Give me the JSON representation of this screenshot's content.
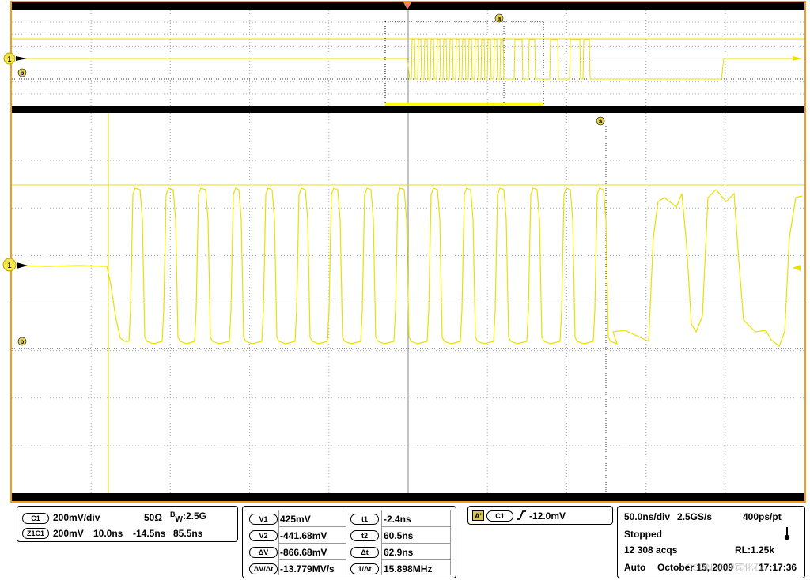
{
  "colors": {
    "frame": "#f59a23",
    "grid": "#9a9a9a",
    "trace": "#e8e000",
    "cursor": "#e8e000",
    "bar": "#000000",
    "background": "#ffffff"
  },
  "overview": {
    "markers": {
      "channel": "1",
      "ref_b": "b",
      "cursor_a": "a"
    }
  },
  "main": {
    "markers": {
      "channel": "1",
      "ref_b": "b",
      "cursor_a": "a"
    }
  },
  "channel_panel": {
    "ch_pill": "C1",
    "scale": "200mV/div",
    "impedance": "50Ω",
    "bw_sup": "B",
    "bw_sub": "W",
    "bandwidth": ":2.5G",
    "zoom_pill": "Z1C1",
    "zoom_scale": "200mV",
    "zoom_time": "10.0ns",
    "zoom_pos": "-14.5ns",
    "zoom_pct": "85.5ns"
  },
  "cursor_panel": {
    "v1_label": "V1",
    "v1_value": "425mV",
    "t1_label": "t1",
    "t1_value": "-2.4ns",
    "v2_label": "V2",
    "v2_value": "-441.68mV",
    "t2_label": "t2",
    "t2_value": "60.5ns",
    "dv_label": "ΔV",
    "dv_value": "-866.68mV",
    "dt_label": "Δt",
    "dt_value": "62.9ns",
    "dvdt_label": "ΔV/Δt",
    "dvdt_value": "-13.779MV/s",
    "inv_label": "1/Δt",
    "inv_value": "15.898MHz"
  },
  "trigger_panel": {
    "mode_pill": "A'",
    "source_pill": "C1",
    "slope_icon": "rising-edge-icon",
    "level": "-12.0mV"
  },
  "acq_panel": {
    "timebase": "50.0ns/div",
    "sample_rate": "2.5GS/s",
    "resolution": "400ps/pt",
    "status": "Stopped",
    "acqs": "12 308 acqs",
    "record_length": "RL:1.25k",
    "trigger_mode": "Auto",
    "date": "October 15, 2009",
    "time": "17:17:36"
  },
  "watermark": "CSDN @迎宾化石"
}
